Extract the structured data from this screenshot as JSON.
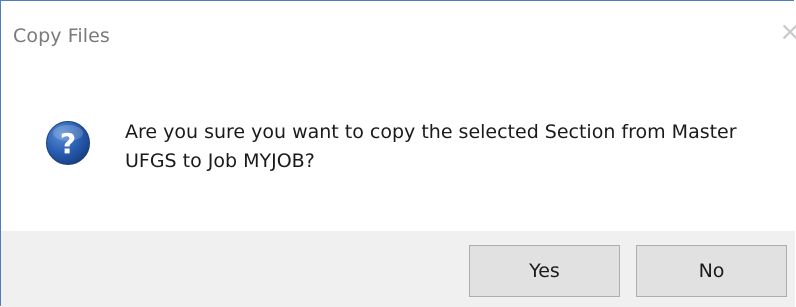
{
  "window": {
    "title": "Copy Files",
    "close_glyph": "×"
  },
  "message": {
    "icon": "question-icon",
    "text": "Are you sure you want to copy the selected Section from Master UFGS to Job MYJOB?"
  },
  "buttons": {
    "yes_label": "Yes",
    "no_label": "No"
  },
  "colors": {
    "icon_blue": "#1d4f9c",
    "footer_bg": "#f0f0f0",
    "button_bg": "#e1e1e1",
    "button_border": "#adadad"
  }
}
